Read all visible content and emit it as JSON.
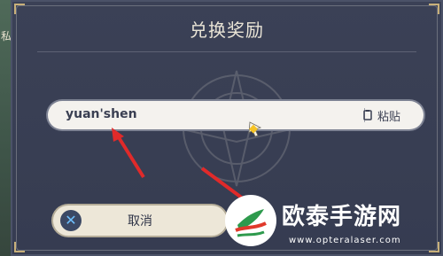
{
  "background": {
    "left_panel_text": "私"
  },
  "dialog": {
    "title": "兑换奖励",
    "input": {
      "value": "yuan'shen",
      "paste_label": "粘贴"
    },
    "cancel_label": "取消"
  },
  "watermark": {
    "title": "欧泰手游网",
    "url": "www.opteralaser.com"
  },
  "colors": {
    "dialog_bg": "#363c51",
    "input_bg": "#f4f2ee",
    "cancel_bg": "#ede7d8",
    "accent_red": "#e02a2a",
    "gold": "#c8b07a"
  },
  "icons": [
    "paste-icon",
    "cancel-x-icon",
    "cursor-icon",
    "watermark-logo-icon"
  ]
}
